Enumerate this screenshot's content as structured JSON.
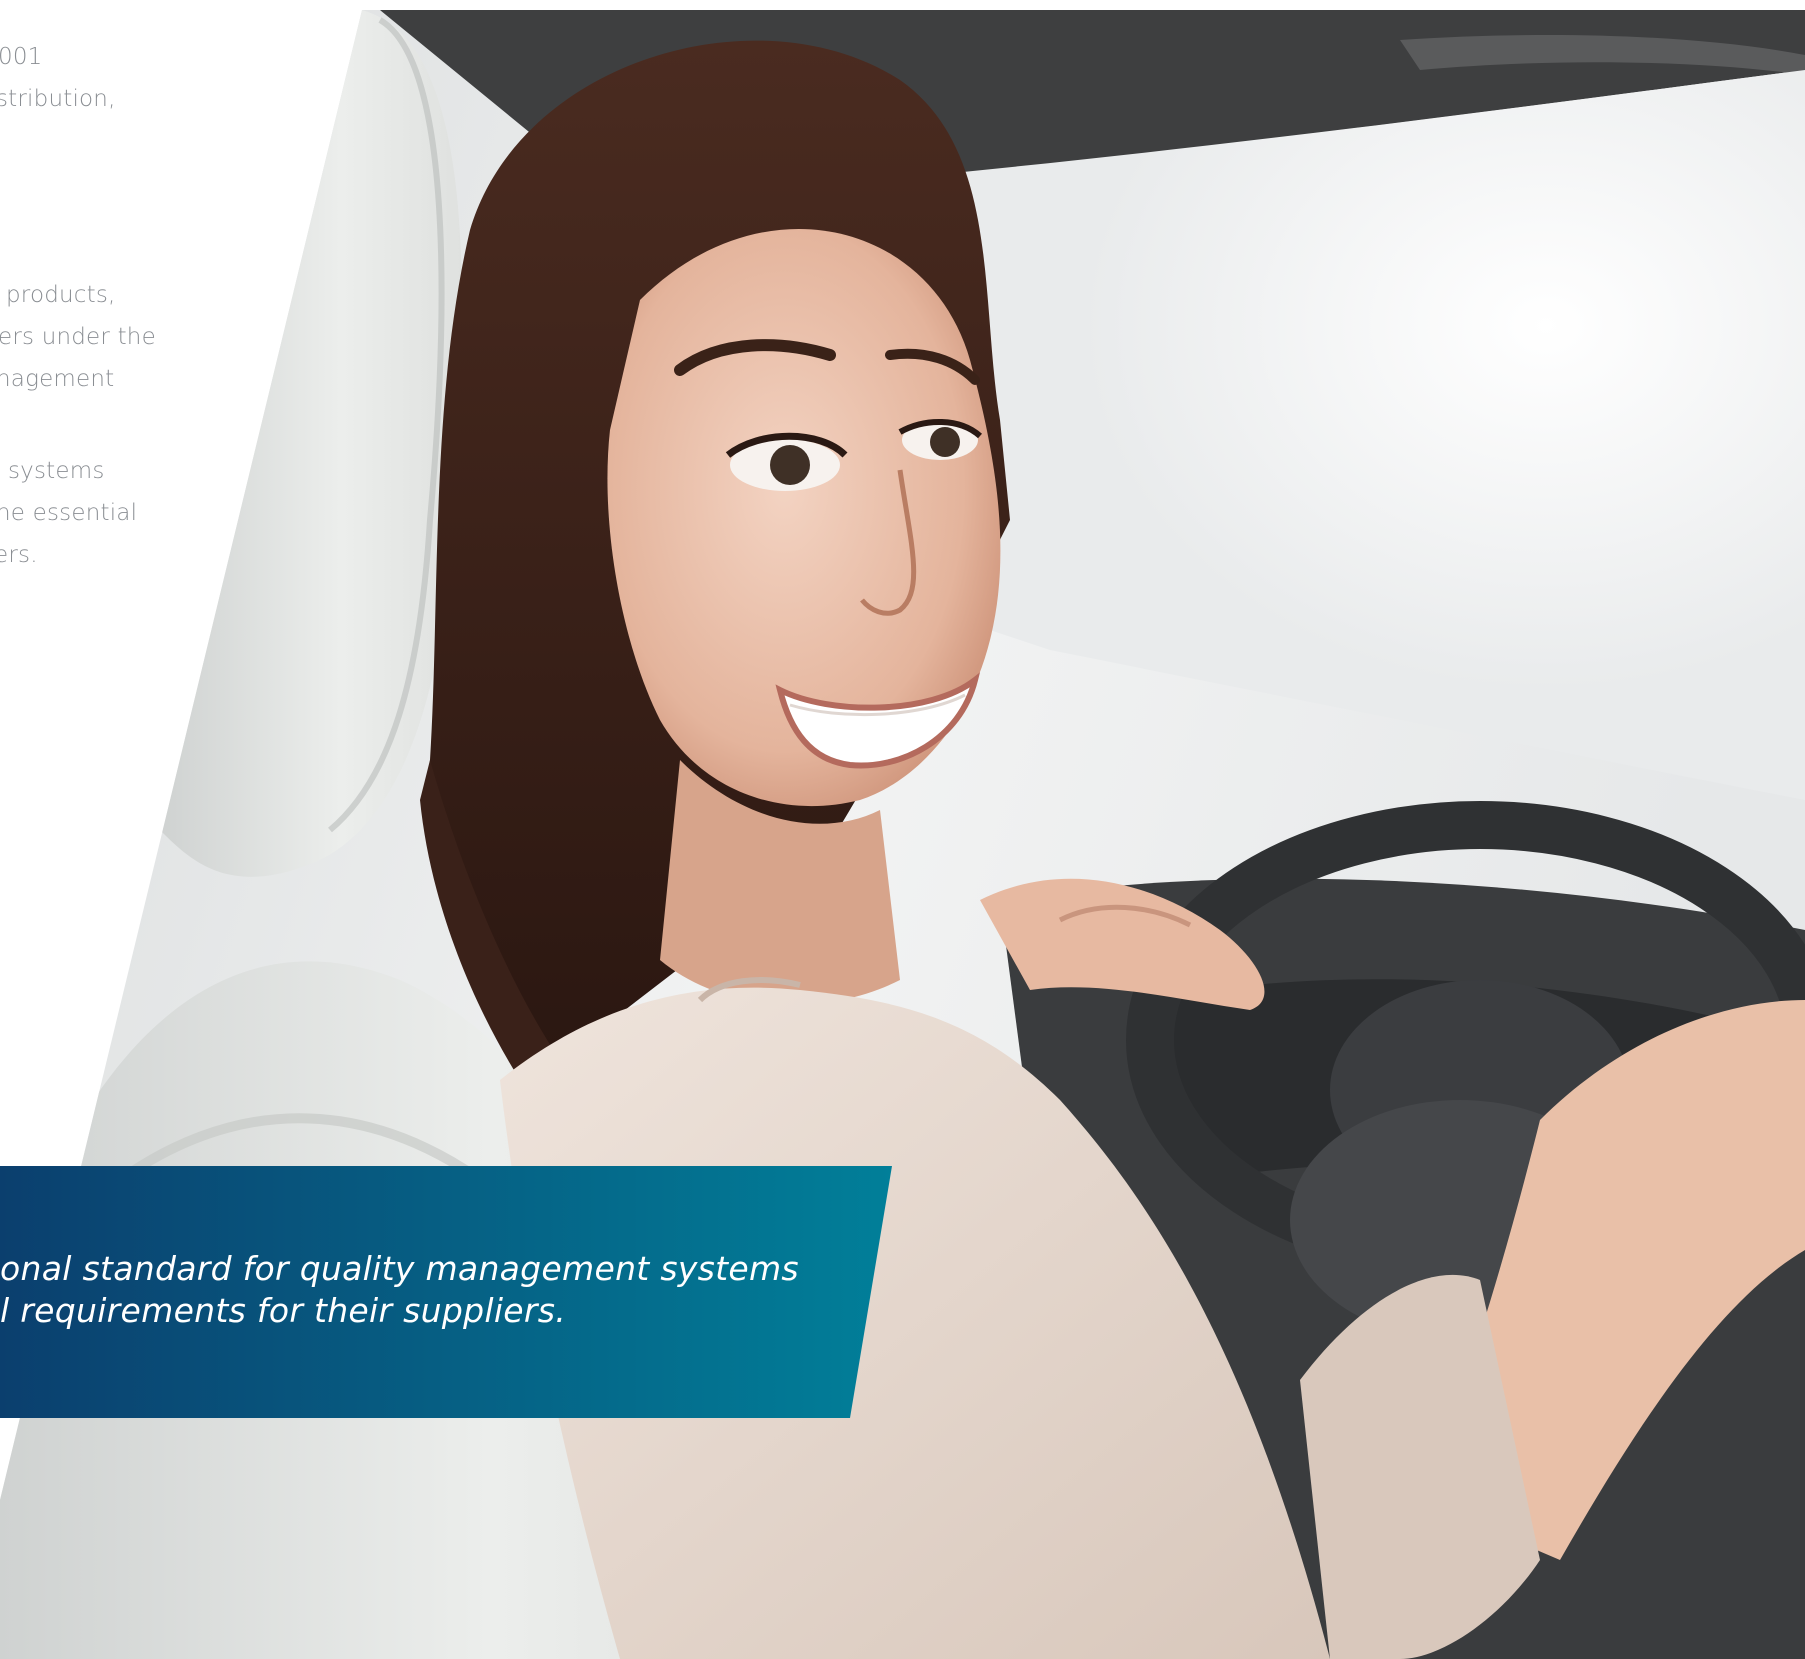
{
  "left_column": {
    "para1": [
      "001",
      "stribution,"
    ],
    "para2": [
      "products,",
      "ers under the",
      "nagement"
    ],
    "para3": [
      "systems",
      "he essential",
      "ers."
    ]
  },
  "banner": {
    "lines": [
      "onal standard for quality management systems",
      "l requirements for their suppliers."
    ]
  },
  "colors": {
    "banner_left": "#0b3f6e",
    "banner_right": "#017f99",
    "body_text": "#8a8e93"
  }
}
